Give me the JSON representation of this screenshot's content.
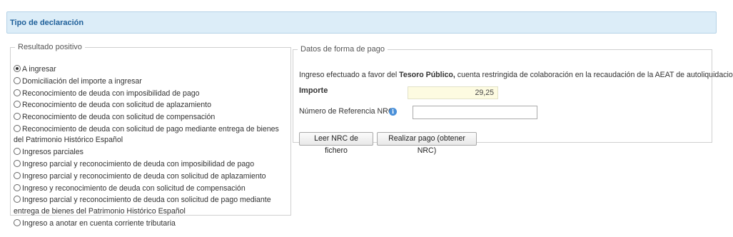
{
  "header": {
    "title": "Tipo de declaración"
  },
  "resultado": {
    "legend": "Resultado positivo",
    "options": [
      {
        "label": "A ingresar",
        "checked": true
      },
      {
        "label": "Domiciliación del importe a ingresar",
        "checked": false
      },
      {
        "label": "Reconocimiento de deuda con imposibilidad de pago",
        "checked": false
      },
      {
        "label": "Reconocimiento de deuda con solicitud de aplazamiento",
        "checked": false
      },
      {
        "label": "Reconocimiento de deuda con solicitud de compensación",
        "checked": false
      },
      {
        "label": "Reconocimiento de deuda con solicitud de pago mediante entrega de bienes del Patrimonio Histórico Español",
        "checked": false
      },
      {
        "label": "Ingresos parciales",
        "checked": false
      },
      {
        "label": "Ingreso parcial y reconocimiento de deuda con imposibilidad de pago",
        "checked": false
      },
      {
        "label": "Ingreso parcial y reconocimiento de deuda con solicitud de aplazamiento",
        "checked": false
      },
      {
        "label": "Ingreso y reconocimiento de deuda con solicitud de compensación",
        "checked": false
      },
      {
        "label": "Ingreso parcial y reconocimiento de deuda con solicitud de pago mediante entrega de bienes del Patrimonio Histórico Español",
        "checked": false
      },
      {
        "label": "Ingreso a anotar en cuenta corriente tributaria",
        "checked": false
      }
    ]
  },
  "pago": {
    "legend": "Datos de forma de pago",
    "desc_pre": "Ingreso efectuado a favor del ",
    "desc_bold": "Tesoro Público,",
    "desc_post": " cuenta restringida de colaboración en la recaudación de la AEAT de autoliquidaciones.",
    "importe_label": "Importe",
    "importe_value": "29,25",
    "nrc_label": "Número de Referencia  NRC:",
    "nrc_value": "",
    "info_icon": "info-icon",
    "btn_leer": "Leer NRC de fichero",
    "btn_pago": "Realizar pago (obtener NRC)"
  }
}
